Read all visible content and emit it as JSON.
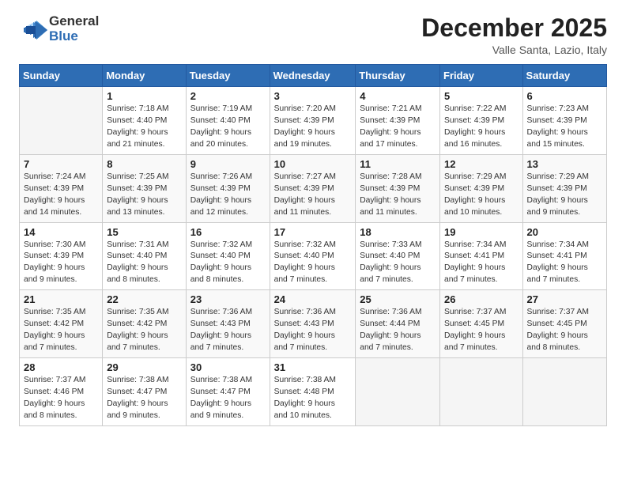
{
  "header": {
    "logo_general": "General",
    "logo_blue": "Blue",
    "title": "December 2025",
    "subtitle": "Valle Santa, Lazio, Italy"
  },
  "calendar": {
    "columns": [
      "Sunday",
      "Monday",
      "Tuesday",
      "Wednesday",
      "Thursday",
      "Friday",
      "Saturday"
    ],
    "rows": [
      [
        {
          "day": "",
          "info": ""
        },
        {
          "day": "1",
          "info": "Sunrise: 7:18 AM\nSunset: 4:40 PM\nDaylight: 9 hours\nand 21 minutes."
        },
        {
          "day": "2",
          "info": "Sunrise: 7:19 AM\nSunset: 4:40 PM\nDaylight: 9 hours\nand 20 minutes."
        },
        {
          "day": "3",
          "info": "Sunrise: 7:20 AM\nSunset: 4:39 PM\nDaylight: 9 hours\nand 19 minutes."
        },
        {
          "day": "4",
          "info": "Sunrise: 7:21 AM\nSunset: 4:39 PM\nDaylight: 9 hours\nand 17 minutes."
        },
        {
          "day": "5",
          "info": "Sunrise: 7:22 AM\nSunset: 4:39 PM\nDaylight: 9 hours\nand 16 minutes."
        },
        {
          "day": "6",
          "info": "Sunrise: 7:23 AM\nSunset: 4:39 PM\nDaylight: 9 hours\nand 15 minutes."
        }
      ],
      [
        {
          "day": "7",
          "info": "Sunrise: 7:24 AM\nSunset: 4:39 PM\nDaylight: 9 hours\nand 14 minutes."
        },
        {
          "day": "8",
          "info": "Sunrise: 7:25 AM\nSunset: 4:39 PM\nDaylight: 9 hours\nand 13 minutes."
        },
        {
          "day": "9",
          "info": "Sunrise: 7:26 AM\nSunset: 4:39 PM\nDaylight: 9 hours\nand 12 minutes."
        },
        {
          "day": "10",
          "info": "Sunrise: 7:27 AM\nSunset: 4:39 PM\nDaylight: 9 hours\nand 11 minutes."
        },
        {
          "day": "11",
          "info": "Sunrise: 7:28 AM\nSunset: 4:39 PM\nDaylight: 9 hours\nand 11 minutes."
        },
        {
          "day": "12",
          "info": "Sunrise: 7:29 AM\nSunset: 4:39 PM\nDaylight: 9 hours\nand 10 minutes."
        },
        {
          "day": "13",
          "info": "Sunrise: 7:29 AM\nSunset: 4:39 PM\nDaylight: 9 hours\nand 9 minutes."
        }
      ],
      [
        {
          "day": "14",
          "info": "Sunrise: 7:30 AM\nSunset: 4:39 PM\nDaylight: 9 hours\nand 9 minutes."
        },
        {
          "day": "15",
          "info": "Sunrise: 7:31 AM\nSunset: 4:40 PM\nDaylight: 9 hours\nand 8 minutes."
        },
        {
          "day": "16",
          "info": "Sunrise: 7:32 AM\nSunset: 4:40 PM\nDaylight: 9 hours\nand 8 minutes."
        },
        {
          "day": "17",
          "info": "Sunrise: 7:32 AM\nSunset: 4:40 PM\nDaylight: 9 hours\nand 7 minutes."
        },
        {
          "day": "18",
          "info": "Sunrise: 7:33 AM\nSunset: 4:40 PM\nDaylight: 9 hours\nand 7 minutes."
        },
        {
          "day": "19",
          "info": "Sunrise: 7:34 AM\nSunset: 4:41 PM\nDaylight: 9 hours\nand 7 minutes."
        },
        {
          "day": "20",
          "info": "Sunrise: 7:34 AM\nSunset: 4:41 PM\nDaylight: 9 hours\nand 7 minutes."
        }
      ],
      [
        {
          "day": "21",
          "info": "Sunrise: 7:35 AM\nSunset: 4:42 PM\nDaylight: 9 hours\nand 7 minutes."
        },
        {
          "day": "22",
          "info": "Sunrise: 7:35 AM\nSunset: 4:42 PM\nDaylight: 9 hours\nand 7 minutes."
        },
        {
          "day": "23",
          "info": "Sunrise: 7:36 AM\nSunset: 4:43 PM\nDaylight: 9 hours\nand 7 minutes."
        },
        {
          "day": "24",
          "info": "Sunrise: 7:36 AM\nSunset: 4:43 PM\nDaylight: 9 hours\nand 7 minutes."
        },
        {
          "day": "25",
          "info": "Sunrise: 7:36 AM\nSunset: 4:44 PM\nDaylight: 9 hours\nand 7 minutes."
        },
        {
          "day": "26",
          "info": "Sunrise: 7:37 AM\nSunset: 4:45 PM\nDaylight: 9 hours\nand 7 minutes."
        },
        {
          "day": "27",
          "info": "Sunrise: 7:37 AM\nSunset: 4:45 PM\nDaylight: 9 hours\nand 8 minutes."
        }
      ],
      [
        {
          "day": "28",
          "info": "Sunrise: 7:37 AM\nSunset: 4:46 PM\nDaylight: 9 hours\nand 8 minutes."
        },
        {
          "day": "29",
          "info": "Sunrise: 7:38 AM\nSunset: 4:47 PM\nDaylight: 9 hours\nand 9 minutes."
        },
        {
          "day": "30",
          "info": "Sunrise: 7:38 AM\nSunset: 4:47 PM\nDaylight: 9 hours\nand 9 minutes."
        },
        {
          "day": "31",
          "info": "Sunrise: 7:38 AM\nSunset: 4:48 PM\nDaylight: 9 hours\nand 10 minutes."
        },
        {
          "day": "",
          "info": ""
        },
        {
          "day": "",
          "info": ""
        },
        {
          "day": "",
          "info": ""
        }
      ]
    ]
  }
}
